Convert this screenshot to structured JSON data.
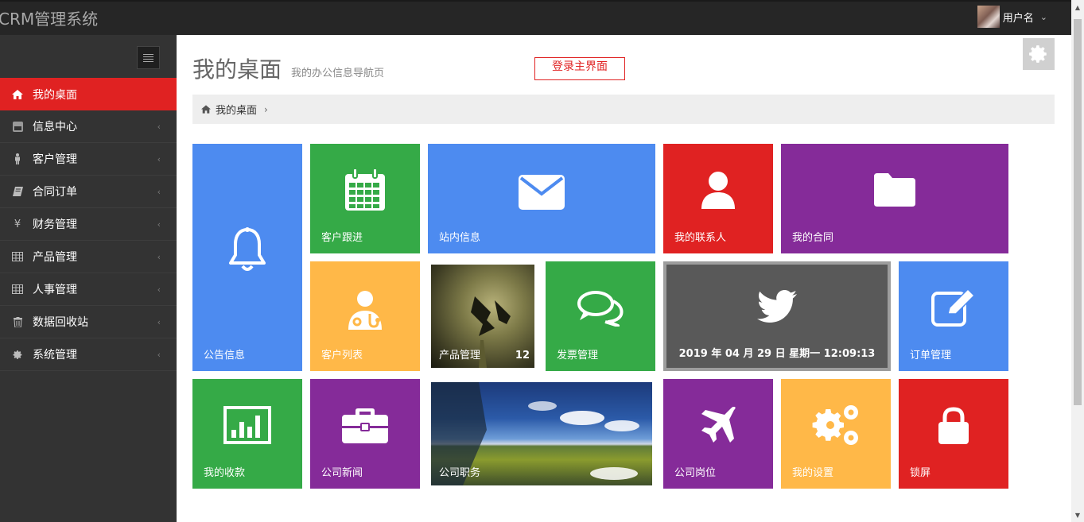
{
  "app": {
    "title": "CRM管理系统"
  },
  "user": {
    "name": "用户名"
  },
  "sidebar": {
    "items": [
      {
        "label": "我的桌面",
        "icon": "home-icon",
        "active": true
      },
      {
        "label": "信息中心",
        "icon": "youtube-icon"
      },
      {
        "label": "客户管理",
        "icon": "male-icon"
      },
      {
        "label": "合同订单",
        "icon": "book-icon"
      },
      {
        "label": "财务管理",
        "icon": "yen-icon"
      },
      {
        "label": "产品管理",
        "icon": "table-icon"
      },
      {
        "label": "人事管理",
        "icon": "table-icon"
      },
      {
        "label": "数据回收站",
        "icon": "trash-icon"
      },
      {
        "label": "系统管理",
        "icon": "cog-icon"
      }
    ]
  },
  "header": {
    "title": "我的桌面",
    "subtitle": "我的办公信息导航页",
    "annotation": "登录主界面"
  },
  "breadcrumb": {
    "current": "我的桌面"
  },
  "tiles": {
    "notice": "公告信息",
    "customer_follow": "客户跟进",
    "site_message": "站内信息",
    "my_contacts": "我的联系人",
    "my_contracts": "我的合同",
    "customer_list": "客户列表",
    "product_mgmt": "产品管理",
    "product_count": "12",
    "invoice_mgmt": "发票管理",
    "datetime": "2019 年 04 月 29 日 星期一 12:09:13",
    "order_mgmt": "订单管理",
    "my_receipts": "我的收款",
    "company_news": "公司新闻",
    "company_duties": "公司职务",
    "company_posts": "公司岗位",
    "my_settings": "我的设置",
    "lock_screen": "锁屏"
  },
  "colors": {
    "red": "#e02222",
    "green": "#35aa47",
    "blue": "#4d8bf0",
    "purple": "#852b99",
    "yellow": "#ffb848",
    "sidebar": "#333333",
    "topbar": "#262626"
  }
}
